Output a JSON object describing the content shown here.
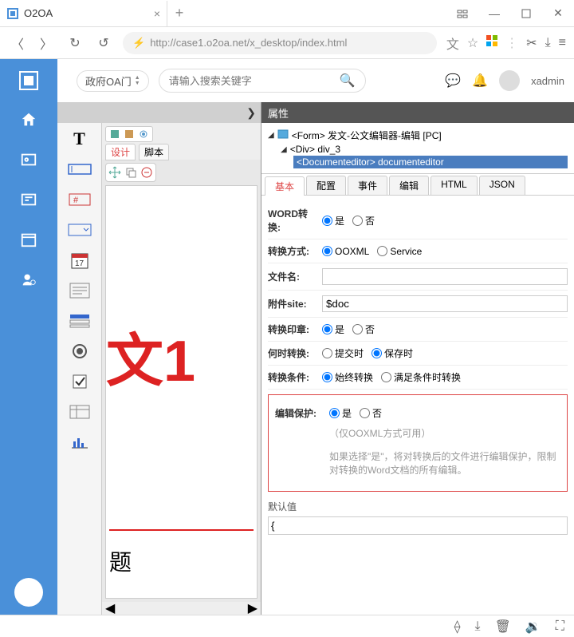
{
  "browser": {
    "tab_title": "O2OA",
    "url_display": "http://case1.o2oa.net/x_desktop/index.html"
  },
  "appbar": {
    "portal_label": "政府OA门",
    "search_placeholder": "请输入搜索关键字",
    "username": "xadmin"
  },
  "center": {
    "tab_design": "设计",
    "tab_script": "脚本",
    "canvas_main_char": "文1",
    "canvas_title_char": "题"
  },
  "props": {
    "panel_title": "属性",
    "tree": {
      "root": "<Form> 发文-公文编辑器-编辑 [PC]",
      "child1": "<Div> div_3",
      "child2": "<Documenteditor> documenteditor"
    },
    "tabs": [
      "基本",
      "配置",
      "事件",
      "编辑",
      "HTML",
      "JSON"
    ],
    "fields": {
      "word_convert_label": "WORD转换:",
      "yes": "是",
      "no": "否",
      "convert_mode_label": "转换方式:",
      "ooxml": "OOXML",
      "service": "Service",
      "filename_label": "文件名:",
      "filename_value": "",
      "attach_site_label": "附件site:",
      "attach_site_value": "$doc",
      "stamp_label": "转换印章:",
      "when_label": "何时转换:",
      "when_submit": "提交时",
      "when_save": "保存时",
      "cond_label": "转换条件:",
      "cond_always": "始终转换",
      "cond_when": "满足条件时转换",
      "protect_label": "编辑保护:",
      "protect_note": "（仅OOXML方式可用）",
      "protect_hint": "如果选择\"是\"，将对转换后的文件进行编辑保护，限制对转换的Word文档的所有编辑。",
      "default_label": "默认值",
      "default_value": "{"
    }
  }
}
